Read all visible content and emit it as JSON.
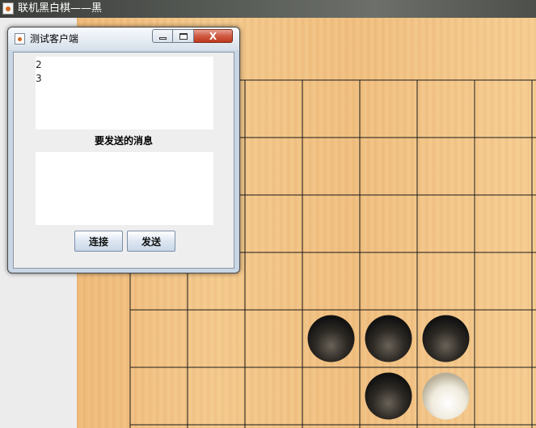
{
  "main_window": {
    "title": "联机黑白棋——黑",
    "icon": "java-cup-icon"
  },
  "board": {
    "background": "#f2c487",
    "line_color": "#1a1a1a",
    "stones": [
      {
        "color": "black",
        "col": 3,
        "row": 4
      },
      {
        "color": "black",
        "col": 4,
        "row": 4
      },
      {
        "color": "black",
        "col": 5,
        "row": 4
      },
      {
        "color": "black",
        "col": 4,
        "row": 5
      },
      {
        "color": "white",
        "col": 5,
        "row": 5
      }
    ]
  },
  "dialog": {
    "title": "测试客户端",
    "icon": "java-cup-icon",
    "minimize_icon": "minimize-icon",
    "maximize_icon": "maximize-icon",
    "close_label": "X",
    "received_lines": [
      "2",
      "3"
    ],
    "message_label": "要发送的消息",
    "send_text": "",
    "connect_label": "连接",
    "send_label": "发送"
  }
}
